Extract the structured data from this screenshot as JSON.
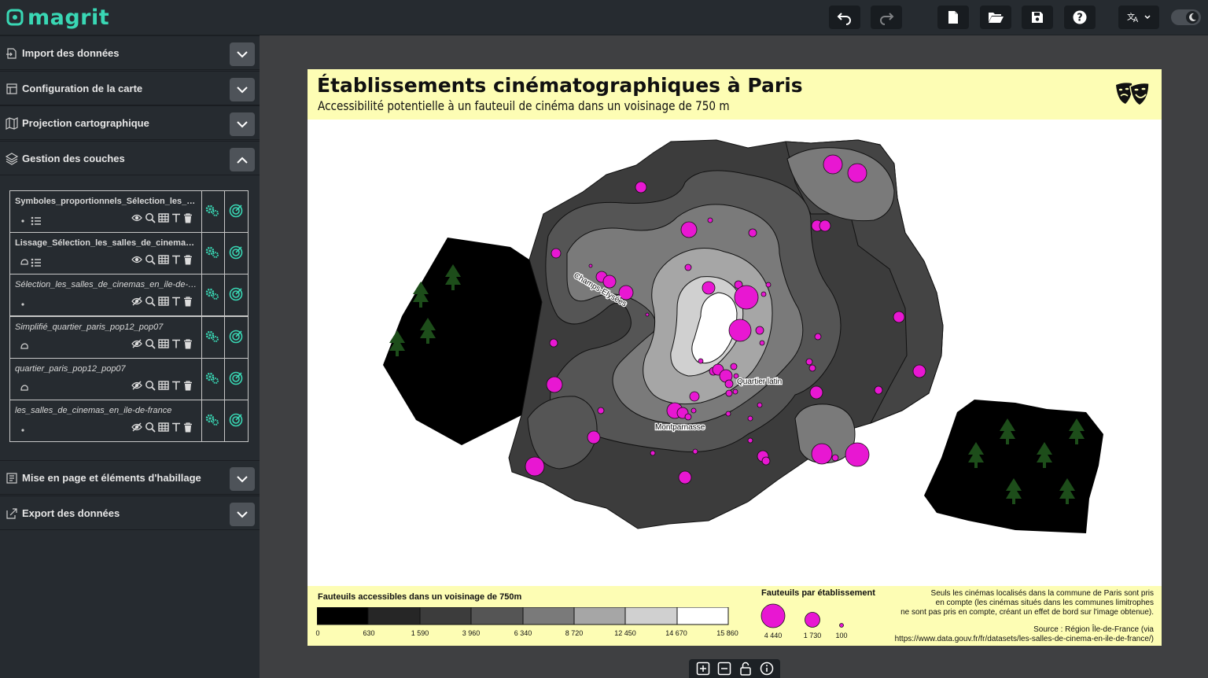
{
  "app": {
    "name": "magrit"
  },
  "toolbar": {
    "undo": "undo-icon",
    "redo": "redo-icon",
    "new": "new-file-icon",
    "open": "open-folder-icon",
    "save": "save-icon",
    "help": "help-icon",
    "language": "translate-icon",
    "theme": "dark-mode"
  },
  "sidebar": {
    "sections": [
      {
        "label": "Import des données",
        "expanded": false
      },
      {
        "label": "Configuration de la carte",
        "expanded": false
      },
      {
        "label": "Projection cartographique",
        "expanded": false
      },
      {
        "label": "Gestion des couches",
        "expanded": true
      },
      {
        "label": "Mise en page et éléments d'habillage",
        "expanded": false
      },
      {
        "label": "Export des données",
        "expanded": false
      }
    ],
    "layers": [
      {
        "name": "Symboles_proportionnels_Sélection_les_salles_de_cinemas",
        "visible": true,
        "bold": true
      },
      {
        "name": "Lissage_Sélection_les_salles_de_cinemas_en_ile-de-france",
        "visible": true,
        "bold": true
      },
      {
        "name": "Sélection_les_salles_de_cinemas_en_ile-de-france",
        "visible": false,
        "bold": false
      },
      {
        "name": "Simplifié_quartier_paris_pop12_pop07",
        "visible": false,
        "bold": false
      },
      {
        "name": "quartier_paris_pop12_pop07",
        "visible": false,
        "bold": false
      },
      {
        "name": "les_salles_de_cinemas_en_ile-de-france",
        "visible": false,
        "bold": false
      }
    ]
  },
  "map": {
    "title": "Établissements cinématographiques à Paris",
    "subtitle": "Accessibilité potentielle à un fauteuil de cinéma dans un voisinage de 750 m",
    "labels": {
      "champs": "Champs-Elysées",
      "latin": "Quartier latin",
      "montparnasse": "Montparnasse"
    },
    "colors": {
      "accent": "#39d7b4",
      "symbol": "#e817d2",
      "band": "#fdfdb4"
    }
  },
  "legend": {
    "choropleth_title": "Fauteuils accessibles dans un voisinage de 750m",
    "breaks": [
      "0",
      "630",
      "1 590",
      "3 960",
      "6 340",
      "8 720",
      "12 450",
      "14 670",
      "15 860"
    ],
    "colors": [
      "#000000",
      "#262626",
      "#3c3c3c",
      "#555555",
      "#7a7a7a",
      "#a6a6a6",
      "#d0d0d0",
      "#ffffff"
    ],
    "symbols_title": "Fauteuils par établissement",
    "symbols": [
      "4 440",
      "1 730",
      "100"
    ]
  },
  "note": {
    "line1": "Seuls les cinémas localisés dans la commune de Paris sont pris",
    "line2": "en compte (les cinémas situés dans les communes limitrophes",
    "line3": "ne sont pas pris en compte, créant un effet de bord sur l'image obtenue).",
    "source1": "Source : Région Île-de-France (via",
    "source2": "https://www.data.gouv.fr/fr/datasets/les-salles-de-cinema-en-ile-de-france/)"
  }
}
